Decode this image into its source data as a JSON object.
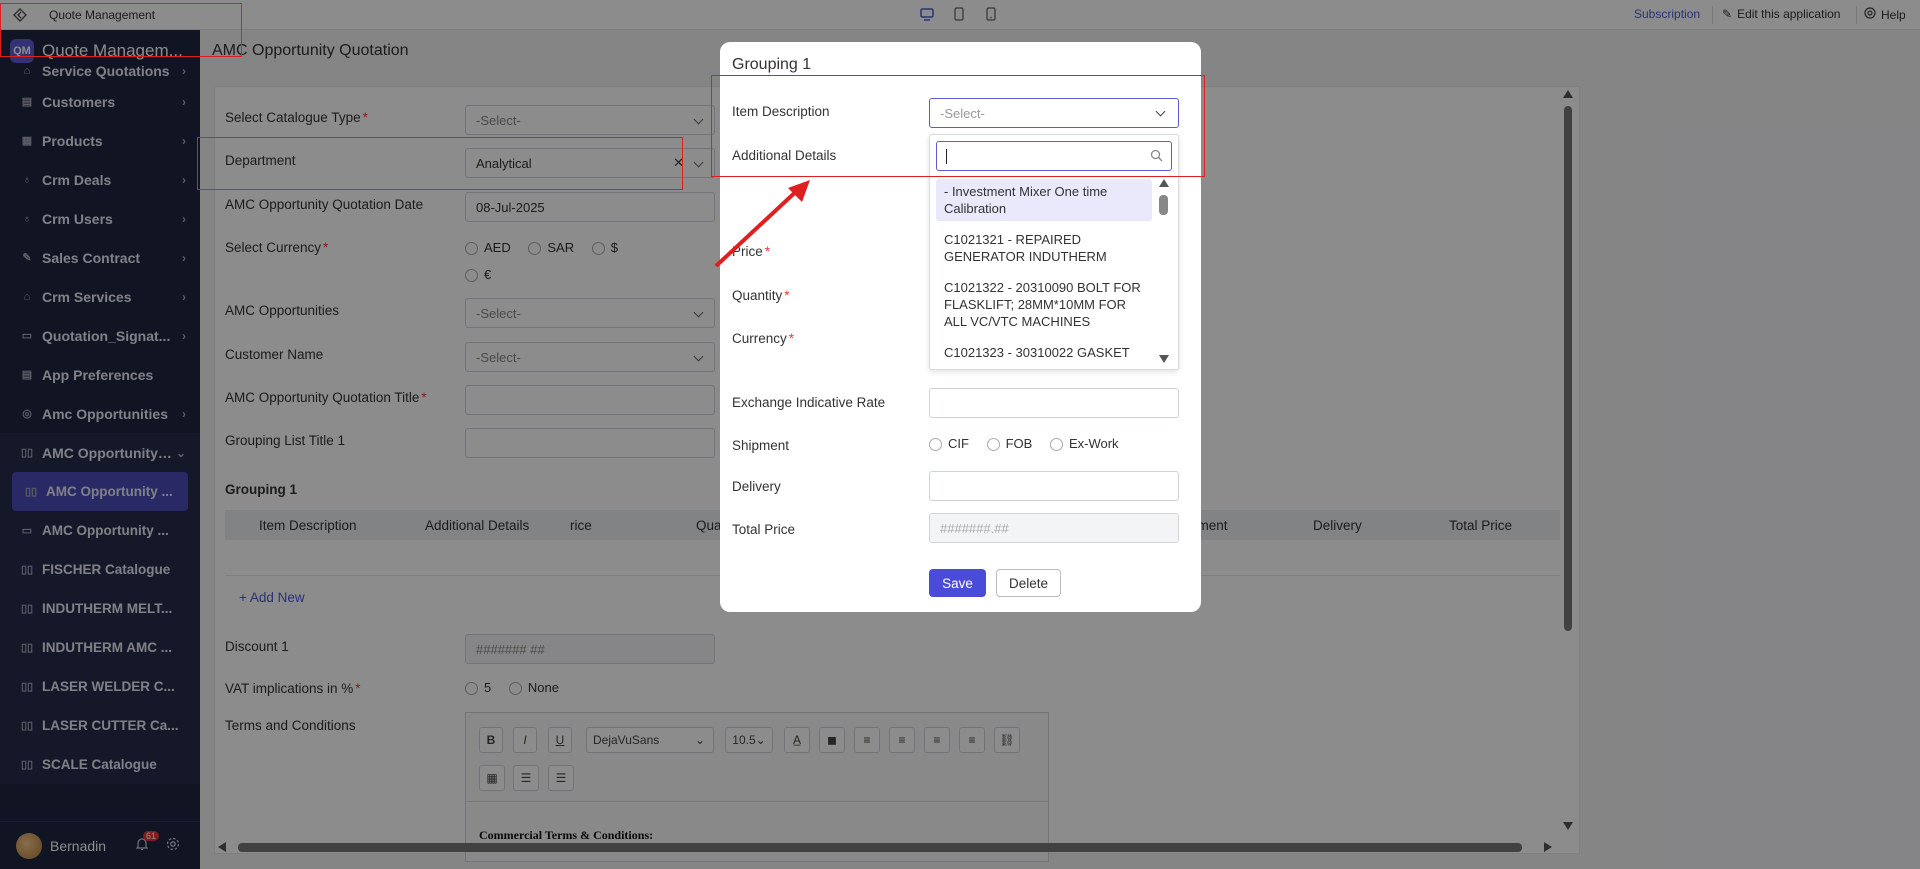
{
  "topbar": {
    "app_title": "Quote Management",
    "subscription": "Subscription",
    "edit_app": "Edit this application",
    "help": "Help"
  },
  "sidebar": {
    "logo": "QM",
    "brand": "Quote Managem...",
    "items": [
      {
        "label": "Service Quotations",
        "icon": "quotation-icon"
      },
      {
        "label": "Customers",
        "icon": "customers-icon"
      },
      {
        "label": "Products",
        "icon": "products-icon"
      },
      {
        "label": "Crm Deals",
        "icon": "deals-icon"
      },
      {
        "label": "Crm Users",
        "icon": "users-icon"
      },
      {
        "label": "Sales Contract",
        "icon": "contract-icon"
      },
      {
        "label": "Crm Services",
        "icon": "services-icon"
      },
      {
        "label": "Quotation_Signat...",
        "icon": "signature-icon"
      },
      {
        "label": "App Preferences",
        "icon": "preferences-icon"
      },
      {
        "label": "Amc Opportunities",
        "icon": "opportunities-icon"
      },
      {
        "label": "AMC Opportunity ...",
        "icon": "grid-icon"
      }
    ],
    "sub_items": [
      {
        "label": "AMC Opportunity ...",
        "active": true
      },
      {
        "label": "AMC Opportunity ...",
        "active": false
      },
      {
        "label": "FISCHER Catalogue",
        "active": false
      },
      {
        "label": "INDUTHERM MELT...",
        "active": false
      },
      {
        "label": "INDUTHERM AMC ...",
        "active": false
      },
      {
        "label": "LASER WELDER C...",
        "active": false
      },
      {
        "label": "LASER CUTTER Ca...",
        "active": false
      },
      {
        "label": "SCALE Catalogue",
        "active": false
      }
    ],
    "user": {
      "name": "Bernadin",
      "notifications": "61"
    }
  },
  "page": {
    "title": "AMC Opportunity Quotation"
  },
  "form": {
    "catalogue_type": {
      "label": "Select Catalogue Type",
      "value": "-Select-"
    },
    "department": {
      "label": "Department",
      "value": "Analytical"
    },
    "quotation_date": {
      "label": "AMC Opportunity Quotation Date",
      "value": "08-Jul-2025"
    },
    "currency": {
      "label": "Select Currency",
      "options": [
        "AED",
        "SAR",
        "$",
        "€"
      ]
    },
    "amc_opportunities": {
      "label": "AMC Opportunities",
      "value": "-Select-"
    },
    "customer_name": {
      "label": "Customer Name",
      "value": "-Select-"
    },
    "quotation_title": {
      "label": "AMC Opportunity Quotation Title"
    },
    "grouping_list_title": {
      "label": "Grouping List Title 1"
    },
    "grouping_title": "Grouping 1",
    "table_headers": [
      "Item Description",
      "Additional Details",
      "rice",
      "Qua",
      "oment",
      "Delivery",
      "Total Price"
    ],
    "add_new": "+ Add New",
    "discount": {
      "label": "Discount 1",
      "placeholder": "####### ##"
    },
    "vat": {
      "label": "VAT implications in %",
      "options": [
        "5",
        "None"
      ]
    },
    "terms": {
      "label": "Terms and Conditions"
    },
    "editor": {
      "bold": "B",
      "italic": "I",
      "underline": "U",
      "font": "DejaVuSans",
      "size": "10.5",
      "content": "Commercial Terms & Conditions:"
    }
  },
  "modal": {
    "title": "Grouping 1",
    "item_description": {
      "label": "Item Description",
      "value": "-Select-"
    },
    "additional_details": {
      "label": "Additional Details"
    },
    "price": {
      "label": "Price"
    },
    "quantity": {
      "label": "Quantity"
    },
    "currency": {
      "label": "Currency"
    },
    "exchange_rate": {
      "label": "Exchange Indicative Rate"
    },
    "shipment": {
      "label": "Shipment",
      "options": [
        "CIF",
        "FOB",
        "Ex-Work"
      ]
    },
    "delivery": {
      "label": "Delivery"
    },
    "total_price": {
      "label": "Total Price",
      "placeholder": "#######.##"
    },
    "save": "Save",
    "delete": "Delete",
    "dropdown_options": [
      "- Investment Mixer One time Calibration",
      "C1021321 - REPAIRED GENERATOR INDUTHERM",
      "C1021322 - 20310090 BOLT FOR FLASKLIFT; 28MM*10MM FOR ALL VC/VTC MACHINES",
      "C1021323 - 30310022 GASKET"
    ]
  },
  "colors": {
    "accent": "#4b4bd9",
    "sidebar_bg": "#1f2540",
    "annotation": "#e02020"
  }
}
